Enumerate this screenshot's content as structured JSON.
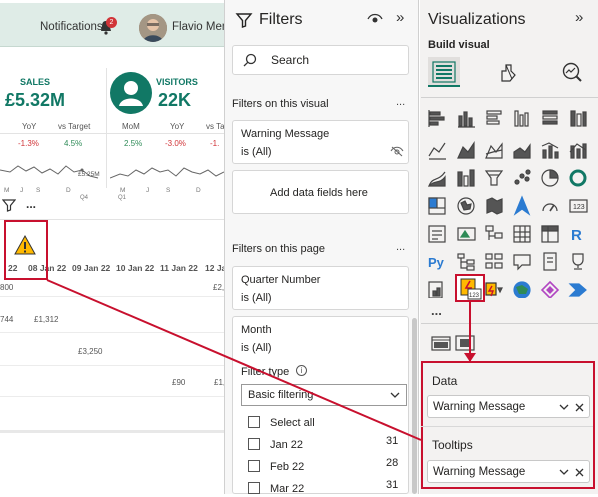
{
  "report": {
    "notifications_label": "Notifications",
    "notifications_count": "2",
    "user_name": "Flavio Mene",
    "sales": {
      "label": "SALES",
      "value": "£5.32M",
      "yoy_label": "YoY",
      "vs_target_label": "vs Target",
      "yoy": "-1.3%",
      "vs_target": "4.5%"
    },
    "visitors": {
      "label": "VISITORS",
      "value": "22K",
      "mom_label": "MoM",
      "yoy_label": "YoY",
      "vs_ta_label": "vs Ta",
      "mom": "2.5%",
      "yoy": "-3.0%",
      "vs_ta": "-1."
    },
    "spark_label": "£5.25M",
    "axis": {
      "m1": "M",
      "j1": "J",
      "s1": "S",
      "d1": "D",
      "q4": "Q4",
      "m2": "M",
      "j2": "J",
      "s2": "S",
      "d2": "D",
      "q1": "Q1"
    },
    "more_label": "...",
    "dates": [
      "22",
      "08 Jan 22",
      "09 Jan 22",
      "10 Jan 22",
      "11 Jan 22",
      "12 Jan 22",
      "13 Ja"
    ],
    "values": {
      "r1a": "800",
      "r1b": "£2,",
      "r2a": "744",
      "r2b": "£1,312",
      "r3": "£3,250",
      "r4": "£90",
      "r4b": "£1,"
    }
  },
  "filters": {
    "title": "Filters",
    "search_placeholder": "Search",
    "on_visual": "Filters on this visual",
    "warning_field": "Warning Message",
    "is_all": "is (All)",
    "add_fields": "Add data fields here",
    "on_page": "Filters on this page",
    "quarter": "Quarter Number",
    "quarter_state": "is (All)",
    "month": "Month",
    "month_state": "is (All)",
    "filter_type_label": "Filter type",
    "filter_type_value": "Basic filtering",
    "options": [
      {
        "label": "Select all",
        "count": ""
      },
      {
        "label": "Jan 22",
        "count": "31"
      },
      {
        "label": "Feb 22",
        "count": "28"
      },
      {
        "label": "Mar 22",
        "count": "31"
      }
    ],
    "more": "..."
  },
  "visualizations": {
    "title": "Visualizations",
    "build_visual": "Build visual",
    "more": "...",
    "data_label": "Data",
    "data_field": "Warning Message",
    "tooltips_label": "Tooltips",
    "tooltips_field": "Warning Message"
  },
  "colors": {
    "accent_teal": "#117865",
    "highlight_red": "#c8102e",
    "panel_bg": "#f3f2f1"
  }
}
